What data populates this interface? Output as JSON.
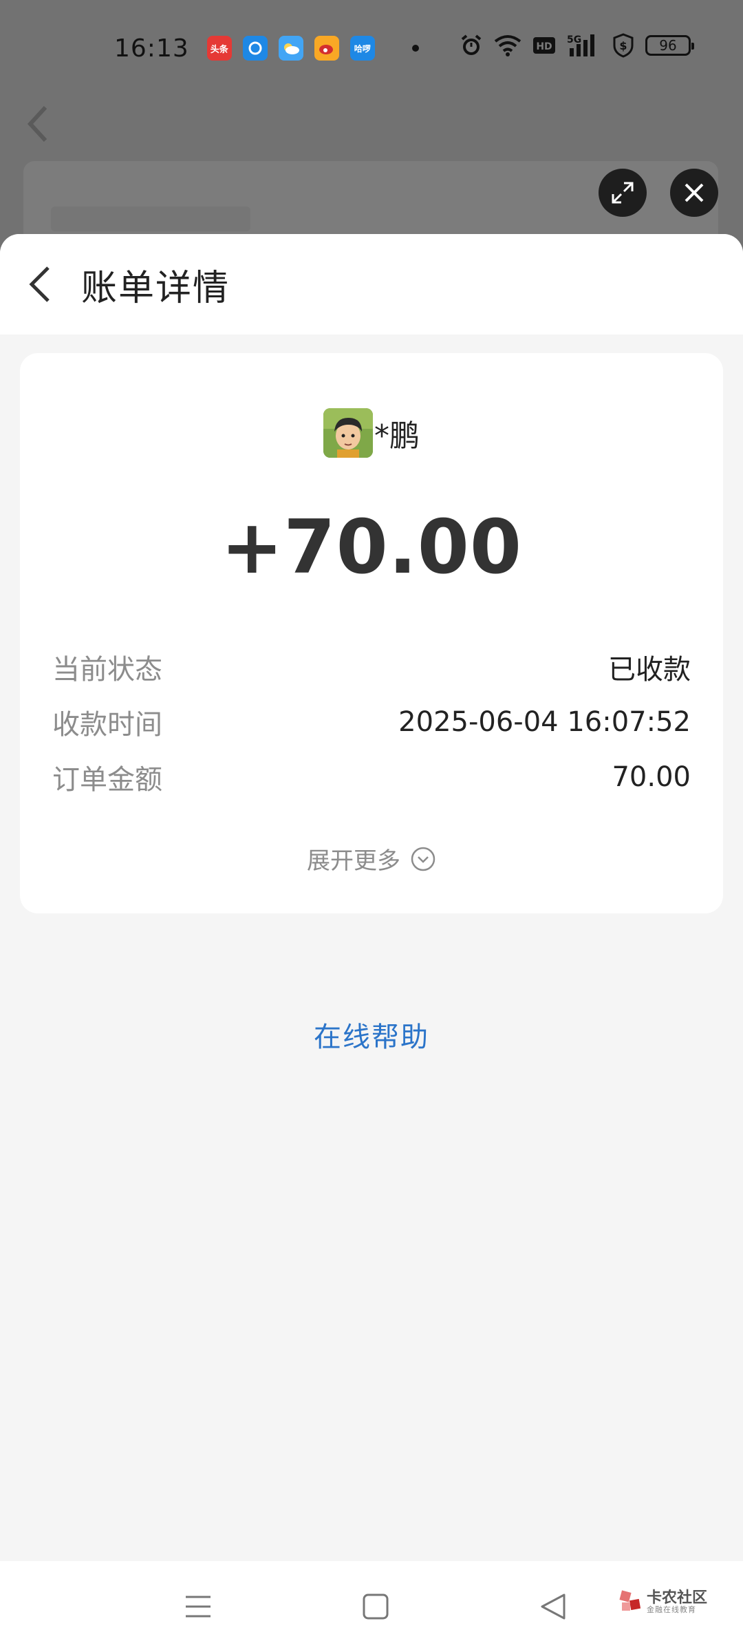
{
  "status_bar": {
    "time": "16:13",
    "notification_icons": [
      {
        "name": "toutiao-app-icon",
        "label": "头条",
        "color": "#e53935"
      },
      {
        "name": "browser-app-icon",
        "label": "e",
        "color": "#1e88e5"
      },
      {
        "name": "weather-app-icon",
        "label": "",
        "color": "#42a5f5"
      },
      {
        "name": "weibo-app-icon",
        "label": "",
        "color": "#f9a825"
      },
      {
        "name": "hello-app-icon",
        "label": "哈啰",
        "color": "#1e88e5"
      }
    ],
    "battery_level": "96"
  },
  "sheet": {
    "title": "账单详情"
  },
  "bill": {
    "payer_name": "*鹏",
    "amount": "+70.00",
    "rows": [
      {
        "label": "当前状态",
        "value": "已收款"
      },
      {
        "label": "收款时间",
        "value": "2025-06-04 16:07:52"
      },
      {
        "label": "订单金额",
        "value": "70.00"
      }
    ],
    "expand_label": "展开更多"
  },
  "help_link": "在线帮助",
  "watermark": {
    "main": "卡农社区",
    "sub": "金融在线教育"
  },
  "colors": {
    "accent_link": "#2b74c9",
    "overlay": "#727272",
    "sheet_bg": "#f5f5f5"
  }
}
